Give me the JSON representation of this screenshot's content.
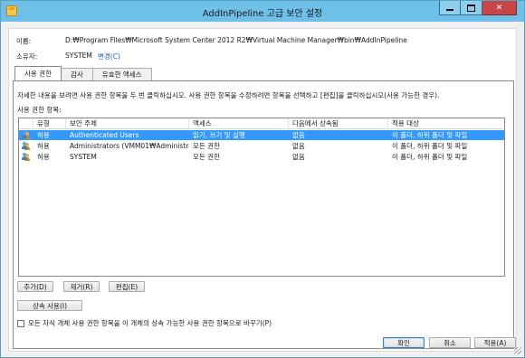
{
  "window": {
    "title": "AddInPipeline 고급 보안 설정",
    "controls": {
      "minimize": "minimize",
      "maximize": "maximize",
      "close": "close"
    }
  },
  "fields": {
    "name_label": "이름:",
    "name_value": "D:₩Program Files₩Microsoft System Center 2012 R2₩Virtual Machine Manager₩bin₩AddInPipeline",
    "owner_label": "소유자:",
    "owner_value": "SYSTEM",
    "owner_change_link": "변경(C)"
  },
  "tabs": [
    {
      "label": "사용 권한",
      "active": true
    },
    {
      "label": "감사",
      "active": false
    },
    {
      "label": "유효한 액세스",
      "active": false
    }
  ],
  "info_text": "자세한 내용을 보려면 사용 권한 항목을 두 번 클릭하십시오. 사용 권한 항목을 수정하려면 항목을 선택하고 [편집]을 클릭하십시오(사용 가능한 경우).",
  "entries_label": "사용 권한 항목:",
  "table": {
    "columns": [
      "유형",
      "보안 주체",
      "액세스",
      "다음에서 상속됨",
      "적용 대상"
    ],
    "rows": [
      {
        "icon": "user-group-icon",
        "type": "허용",
        "principal": "Authenticated Users",
        "access": "읽기, 쓰기 및 실행",
        "inherited": "없음",
        "applies": "이 폴더, 하위 폴더 및 파일",
        "selected": true
      },
      {
        "icon": "user-group-icon",
        "type": "허용",
        "principal": "Administrators (VMM01₩Administrat...",
        "access": "모든 권한",
        "inherited": "없음",
        "applies": "이 폴더, 하위 폴더 및 파일",
        "selected": false
      },
      {
        "icon": "user-group-icon",
        "type": "허용",
        "principal": "SYSTEM",
        "access": "모든 권한",
        "inherited": "없음",
        "applies": "이 폴더, 하위 폴더 및 파일",
        "selected": false
      }
    ]
  },
  "buttons": {
    "add": "추가(D)",
    "remove": "제거(R)",
    "edit": "편집(E)",
    "inherit": "상속 사용(I)",
    "ok": "확인",
    "cancel": "취소",
    "apply": "적용(A)"
  },
  "checkbox": {
    "label": "모든 자식 개체 사용 권한 항목을 이 개체의 상속 가능한 사용 권한 항목으로 바꾸기(P)",
    "checked": false
  },
  "colors": {
    "titlebar": "#6ec0e8",
    "selection": "#3399ff",
    "link": "#1c5fb8",
    "close": "#c84646"
  }
}
